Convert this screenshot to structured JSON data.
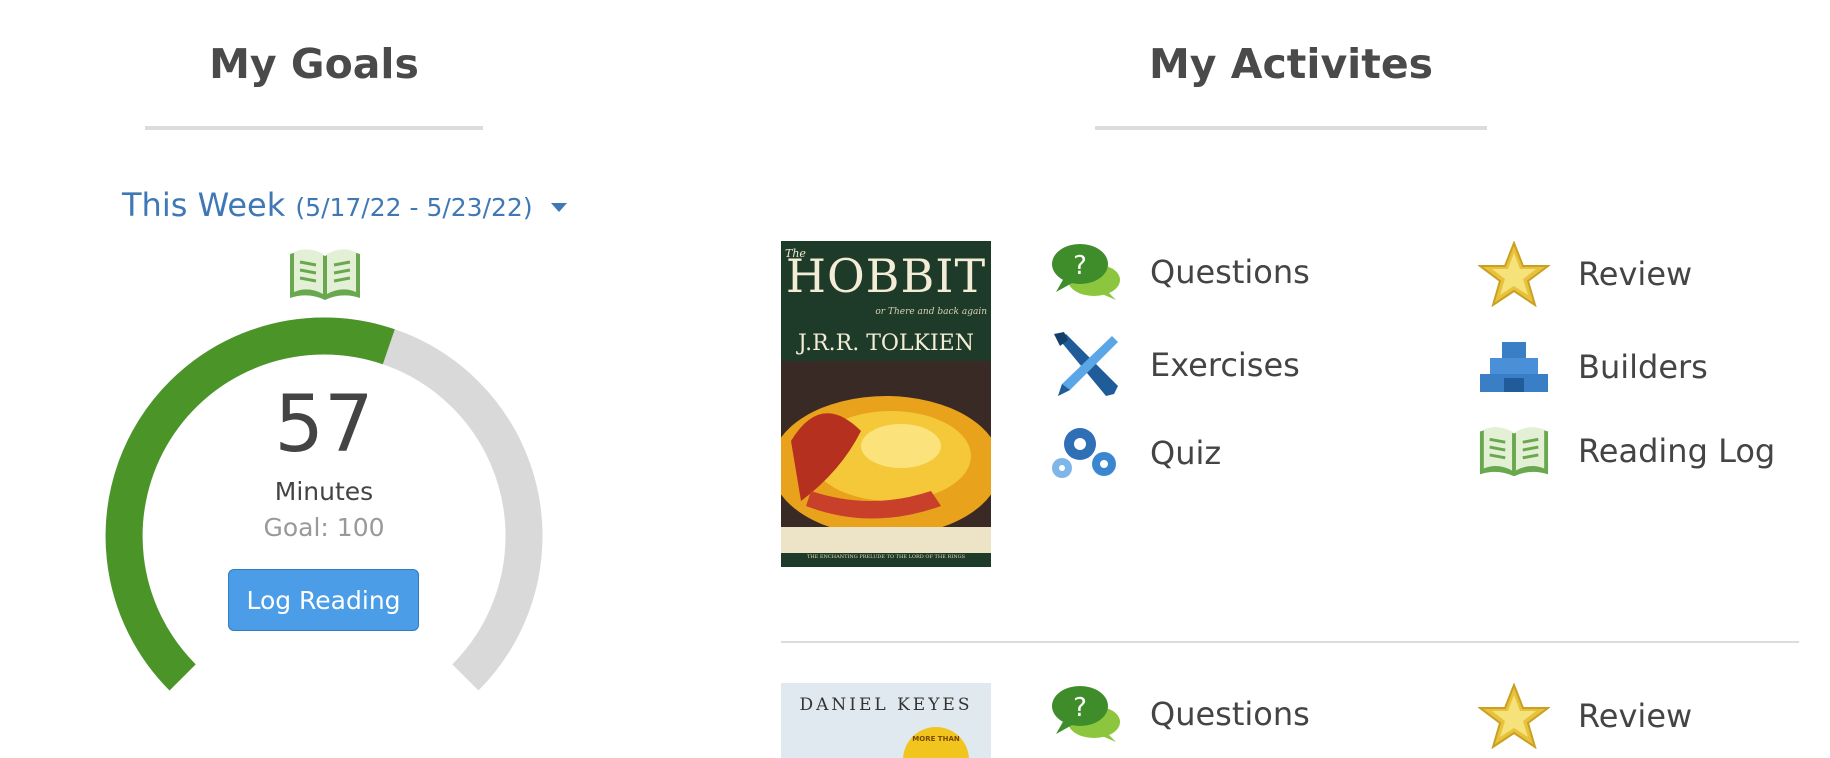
{
  "goals": {
    "heading": "My Goals",
    "week_label": "This Week",
    "week_range": "(5/17/22 - 5/23/22)",
    "gauge": {
      "value": "57",
      "unit": "Minutes",
      "goal_text": "Goal: 100",
      "progress_fraction": 0.57
    },
    "log_button": "Log Reading",
    "colors": {
      "progress": "#4a9428",
      "track": "#d9d9d9",
      "button": "#4a9de6",
      "link": "#3f78b5"
    }
  },
  "activities": {
    "heading": "My Activites",
    "books": [
      {
        "cover": {
          "title": "HOBBIT",
          "title_prefix": "The",
          "subtitle": "or There and back again",
          "author": "J.R.R. TOLKIEN",
          "tagline": "THE ENCHANTING PRELUDE TO THE LORD OF THE RINGS"
        },
        "items": [
          {
            "label": "Questions",
            "icon": "questions-icon"
          },
          {
            "label": "Review",
            "icon": "star-icon"
          },
          {
            "label": "Exercises",
            "icon": "pencil-brush-icon"
          },
          {
            "label": "Builders",
            "icon": "blocks-icon"
          },
          {
            "label": "Quiz",
            "icon": "gears-icon"
          },
          {
            "label": "Reading Log",
            "icon": "book-icon"
          }
        ]
      },
      {
        "cover": {
          "author": "DANIEL KEYES",
          "badge": "MORE THAN"
        },
        "items": [
          {
            "label": "Questions",
            "icon": "questions-icon"
          },
          {
            "label": "Review",
            "icon": "star-icon"
          }
        ]
      }
    ]
  }
}
